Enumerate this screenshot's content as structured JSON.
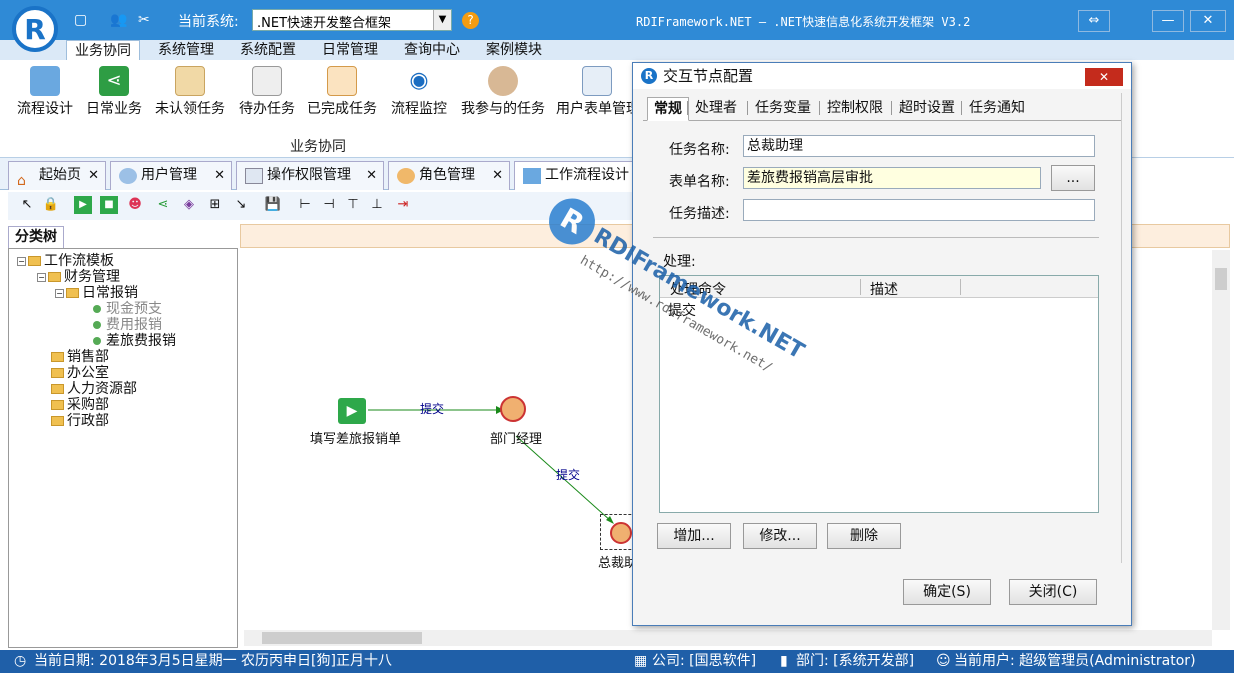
{
  "titlebar": {
    "system_label": "当前系统:",
    "system_value": ".NET快速开发整合框架",
    "app_title": "RDIFramework.NET — .NET快速信息化系统开发框架 V3.2",
    "logo_letter": "R"
  },
  "ribbon_tabs": [
    "业务协同",
    "系统管理",
    "系统配置",
    "日常管理",
    "查询中心",
    "案例模块"
  ],
  "ribbon_buttons": [
    "流程设计",
    "日常业务",
    "未认领任务",
    "待办任务",
    "已完成任务",
    "流程监控",
    "我参与的任务",
    "用户表单管理"
  ],
  "ribbon_group_label": "业务协同",
  "doc_tabs": [
    "起始页",
    "用户管理",
    "操作权限管理",
    "角色管理",
    "工作流程设计"
  ],
  "tree": {
    "tab_label": "分类树",
    "nodes": [
      "工作流模板",
      "财务管理",
      "日常报销",
      "现金预支",
      "费用报销",
      "差旅费报销",
      "销售部",
      "办公室",
      "人力资源部",
      "采购部",
      "行政部"
    ]
  },
  "flow": {
    "node_start": "填写差旅报销单",
    "node_manager": "部门经理",
    "node_boss": "总裁助",
    "edge1": "提交",
    "edge2": "提交"
  },
  "watermark": {
    "text": "RDIFramework.NET",
    "url": "http://www.rdiframework.net/"
  },
  "dialog": {
    "title": "交互节点配置",
    "tabs": [
      "常规",
      "处理者",
      "任务变量",
      "控制权限",
      "超时设置",
      "任务通知"
    ],
    "task_name_label": "任务名称:",
    "task_name_value": "总裁助理",
    "form_name_label": "表单名称:",
    "form_name_value": "差旅费报销高层审批",
    "browse_label": "...",
    "task_desc_label": "任务描述:",
    "task_desc_value": "",
    "process_label": "处理:",
    "col_command": "处理命令",
    "col_desc": "描述",
    "rows": [
      "提交"
    ],
    "add_label": "增加...",
    "edit_label": "修改...",
    "delete_label": "删除",
    "ok_label": "确定(S)",
    "close_label": "关闭(C)"
  },
  "statusbar": {
    "date": "当前日期: 2018年3月5日星期一 农历丙申日[狗]正月十八",
    "company": "公司: [国思软件]",
    "dept": "部门: [系统开发部]",
    "user": "当前用户: 超级管理员(Administrator)"
  },
  "colors": {
    "titlebar": "#2f8ad6",
    "statusbar": "#1f5fa8",
    "close": "#c42b1c",
    "form_highlight": "#ffffe0"
  }
}
